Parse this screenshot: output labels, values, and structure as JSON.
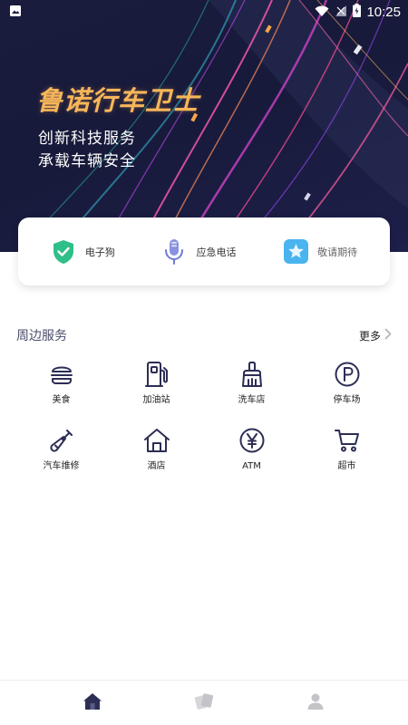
{
  "status_bar": {
    "time": "10:25",
    "icons": [
      "image-icon",
      "wifi-icon",
      "signal-icon",
      "battery-icon"
    ]
  },
  "hero": {
    "brand": "鲁诺行车卫士",
    "slogan_line1": "创新科技服务",
    "slogan_line2": "承载车辆安全",
    "colors": {
      "background": "#1a1c3e",
      "brand": "#f6b65a"
    }
  },
  "quick_actions": [
    {
      "label": "电子狗",
      "icon": "shield-check-icon",
      "color": "#2fbf88"
    },
    {
      "label": "应急电话",
      "icon": "microphone-icon",
      "color": "#6f7bd6"
    },
    {
      "label": "敬请期待",
      "icon": "star-icon",
      "color": "#49b4ee"
    }
  ],
  "nearby": {
    "title": "周边服务",
    "more_label": "更多",
    "items": [
      {
        "label": "美食",
        "icon": "burger-icon"
      },
      {
        "label": "加油站",
        "icon": "gas-station-icon"
      },
      {
        "label": "洗车店",
        "icon": "brush-icon"
      },
      {
        "label": "停车场",
        "icon": "parking-icon"
      },
      {
        "label": "汽车维修",
        "icon": "screwdriver-icon"
      },
      {
        "label": "酒店",
        "icon": "house-icon"
      },
      {
        "label": "ATM",
        "icon": "yen-icon"
      },
      {
        "label": "超市",
        "icon": "cart-icon"
      }
    ]
  },
  "bottom_nav": {
    "tabs": [
      {
        "icon": "home-icon",
        "active": true
      },
      {
        "icon": "cards-icon",
        "active": false
      },
      {
        "icon": "profile-icon",
        "active": false
      }
    ],
    "colors": {
      "active": "#2c2e54",
      "inactive": "#c4c4c8"
    }
  }
}
